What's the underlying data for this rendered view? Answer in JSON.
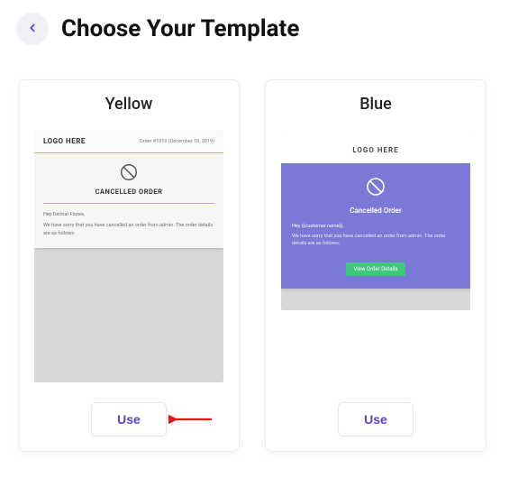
{
  "header": {
    "title": "Choose Your Template"
  },
  "templates": [
    {
      "name": "Yellow",
      "use_label": "Use",
      "has_arrow": true,
      "preview": {
        "logo": "LOGO HERE",
        "order_meta": "Order #1010 (December 18, 2019)",
        "cancelled_label": "CANCELLED ORDER",
        "greeting": "Hey Delmar Florea,",
        "message": "We have sorry that you have cancelled an order from admin. The order details are as follows:"
      }
    },
    {
      "name": "Blue",
      "use_label": "Use",
      "has_arrow": false,
      "preview": {
        "logo": "LOGO HERE",
        "cancelled_label": "Cancelled Order",
        "greeting": "Hey {{customer.name}},",
        "message": "We have sorry that you have cancelled an order from admin. The order details are as follows:",
        "view_button": "View Order Details"
      }
    }
  ]
}
